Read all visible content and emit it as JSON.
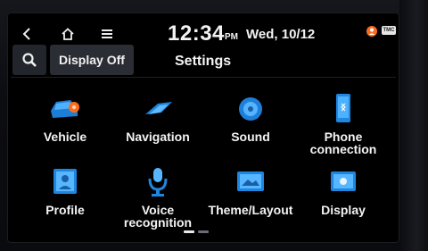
{
  "status": {
    "time": "12:34",
    "ampm": "PM",
    "date": "Wed, 10/12",
    "tmc_badge": "TMC"
  },
  "toolbar": {
    "display_off_label": "Display Off",
    "title": "Settings"
  },
  "tiles": [
    {
      "label": "Vehicle",
      "icon": "vehicle-icon"
    },
    {
      "label": "Navigation",
      "icon": "navigation-icon"
    },
    {
      "label": "Sound",
      "icon": "sound-icon"
    },
    {
      "label": "Phone\nconnection",
      "icon": "phone-connection-icon"
    },
    {
      "label": "Profile",
      "icon": "profile-icon"
    },
    {
      "label": "Voice\nrecognition",
      "icon": "voice-recognition-icon"
    },
    {
      "label": "Theme/Layout",
      "icon": "theme-layout-icon"
    },
    {
      "label": "Display",
      "icon": "display-icon"
    }
  ],
  "pager": {
    "pages": 2,
    "current": 1
  },
  "colors": {
    "accent_blue": "#1f8fe0",
    "accent_orange": "#ff6a1a"
  }
}
